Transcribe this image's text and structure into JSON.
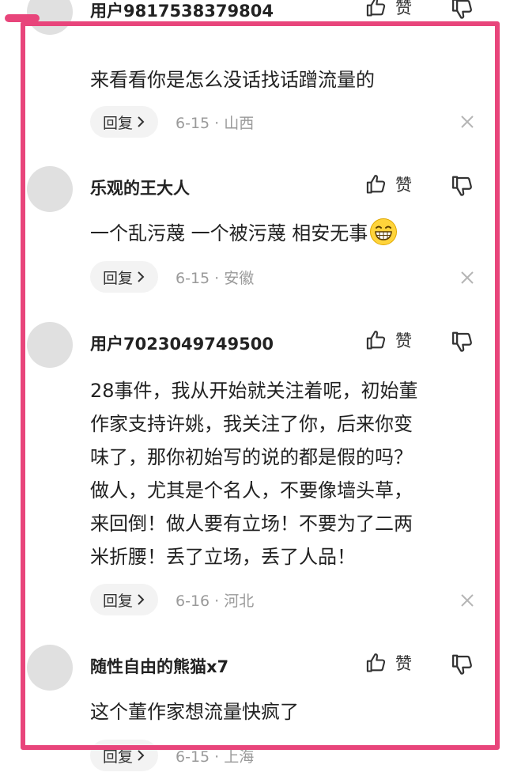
{
  "comments": [
    {
      "user": "用户9817538379804",
      "like_label": "赞",
      "lines": [
        "来看看你是怎么没话找话蹭流量的"
      ],
      "reply_label": "回复",
      "meta": "6-15 · 山西"
    },
    {
      "user": "乐观的王大人",
      "like_label": "赞",
      "lines": [
        "一个乱污蔑 一个被污蔑 相安无事"
      ],
      "emoji": "grinning-face-emoji",
      "reply_label": "回复",
      "meta": "6-15 · 安徽"
    },
    {
      "user": "用户7023049749500",
      "like_label": "赞",
      "lines": [
        "28事件，我从开始就关注着呢，初始董",
        "作家支持许姚，我关注了你，后来你变",
        "味了，那你初始写的说的都是假的吗？",
        "做人，尤其是个名人，不要像墙头草，",
        "来回倒！做人要有立场！不要为了二两",
        "米折腰！丢了立场，丢了人品！"
      ],
      "reply_label": "回复",
      "meta": "6-16 · 河北"
    },
    {
      "user": "随性自由的熊猫x7",
      "like_label": "赞",
      "lines": [
        "这个董作家想流量快疯了"
      ],
      "reply_label": "回复",
      "meta": "6-15 · 上海"
    }
  ],
  "icons": {
    "like": "thumbs-up-icon",
    "dislike": "thumbs-down-icon",
    "reply_arrow": "chevron-right-icon",
    "close": "close-icon"
  },
  "colors": {
    "frame": "#e8457b",
    "avatar": "#e0e0e0",
    "meta": "#9a9a9a",
    "reply_bg": "#f3f3f3"
  }
}
